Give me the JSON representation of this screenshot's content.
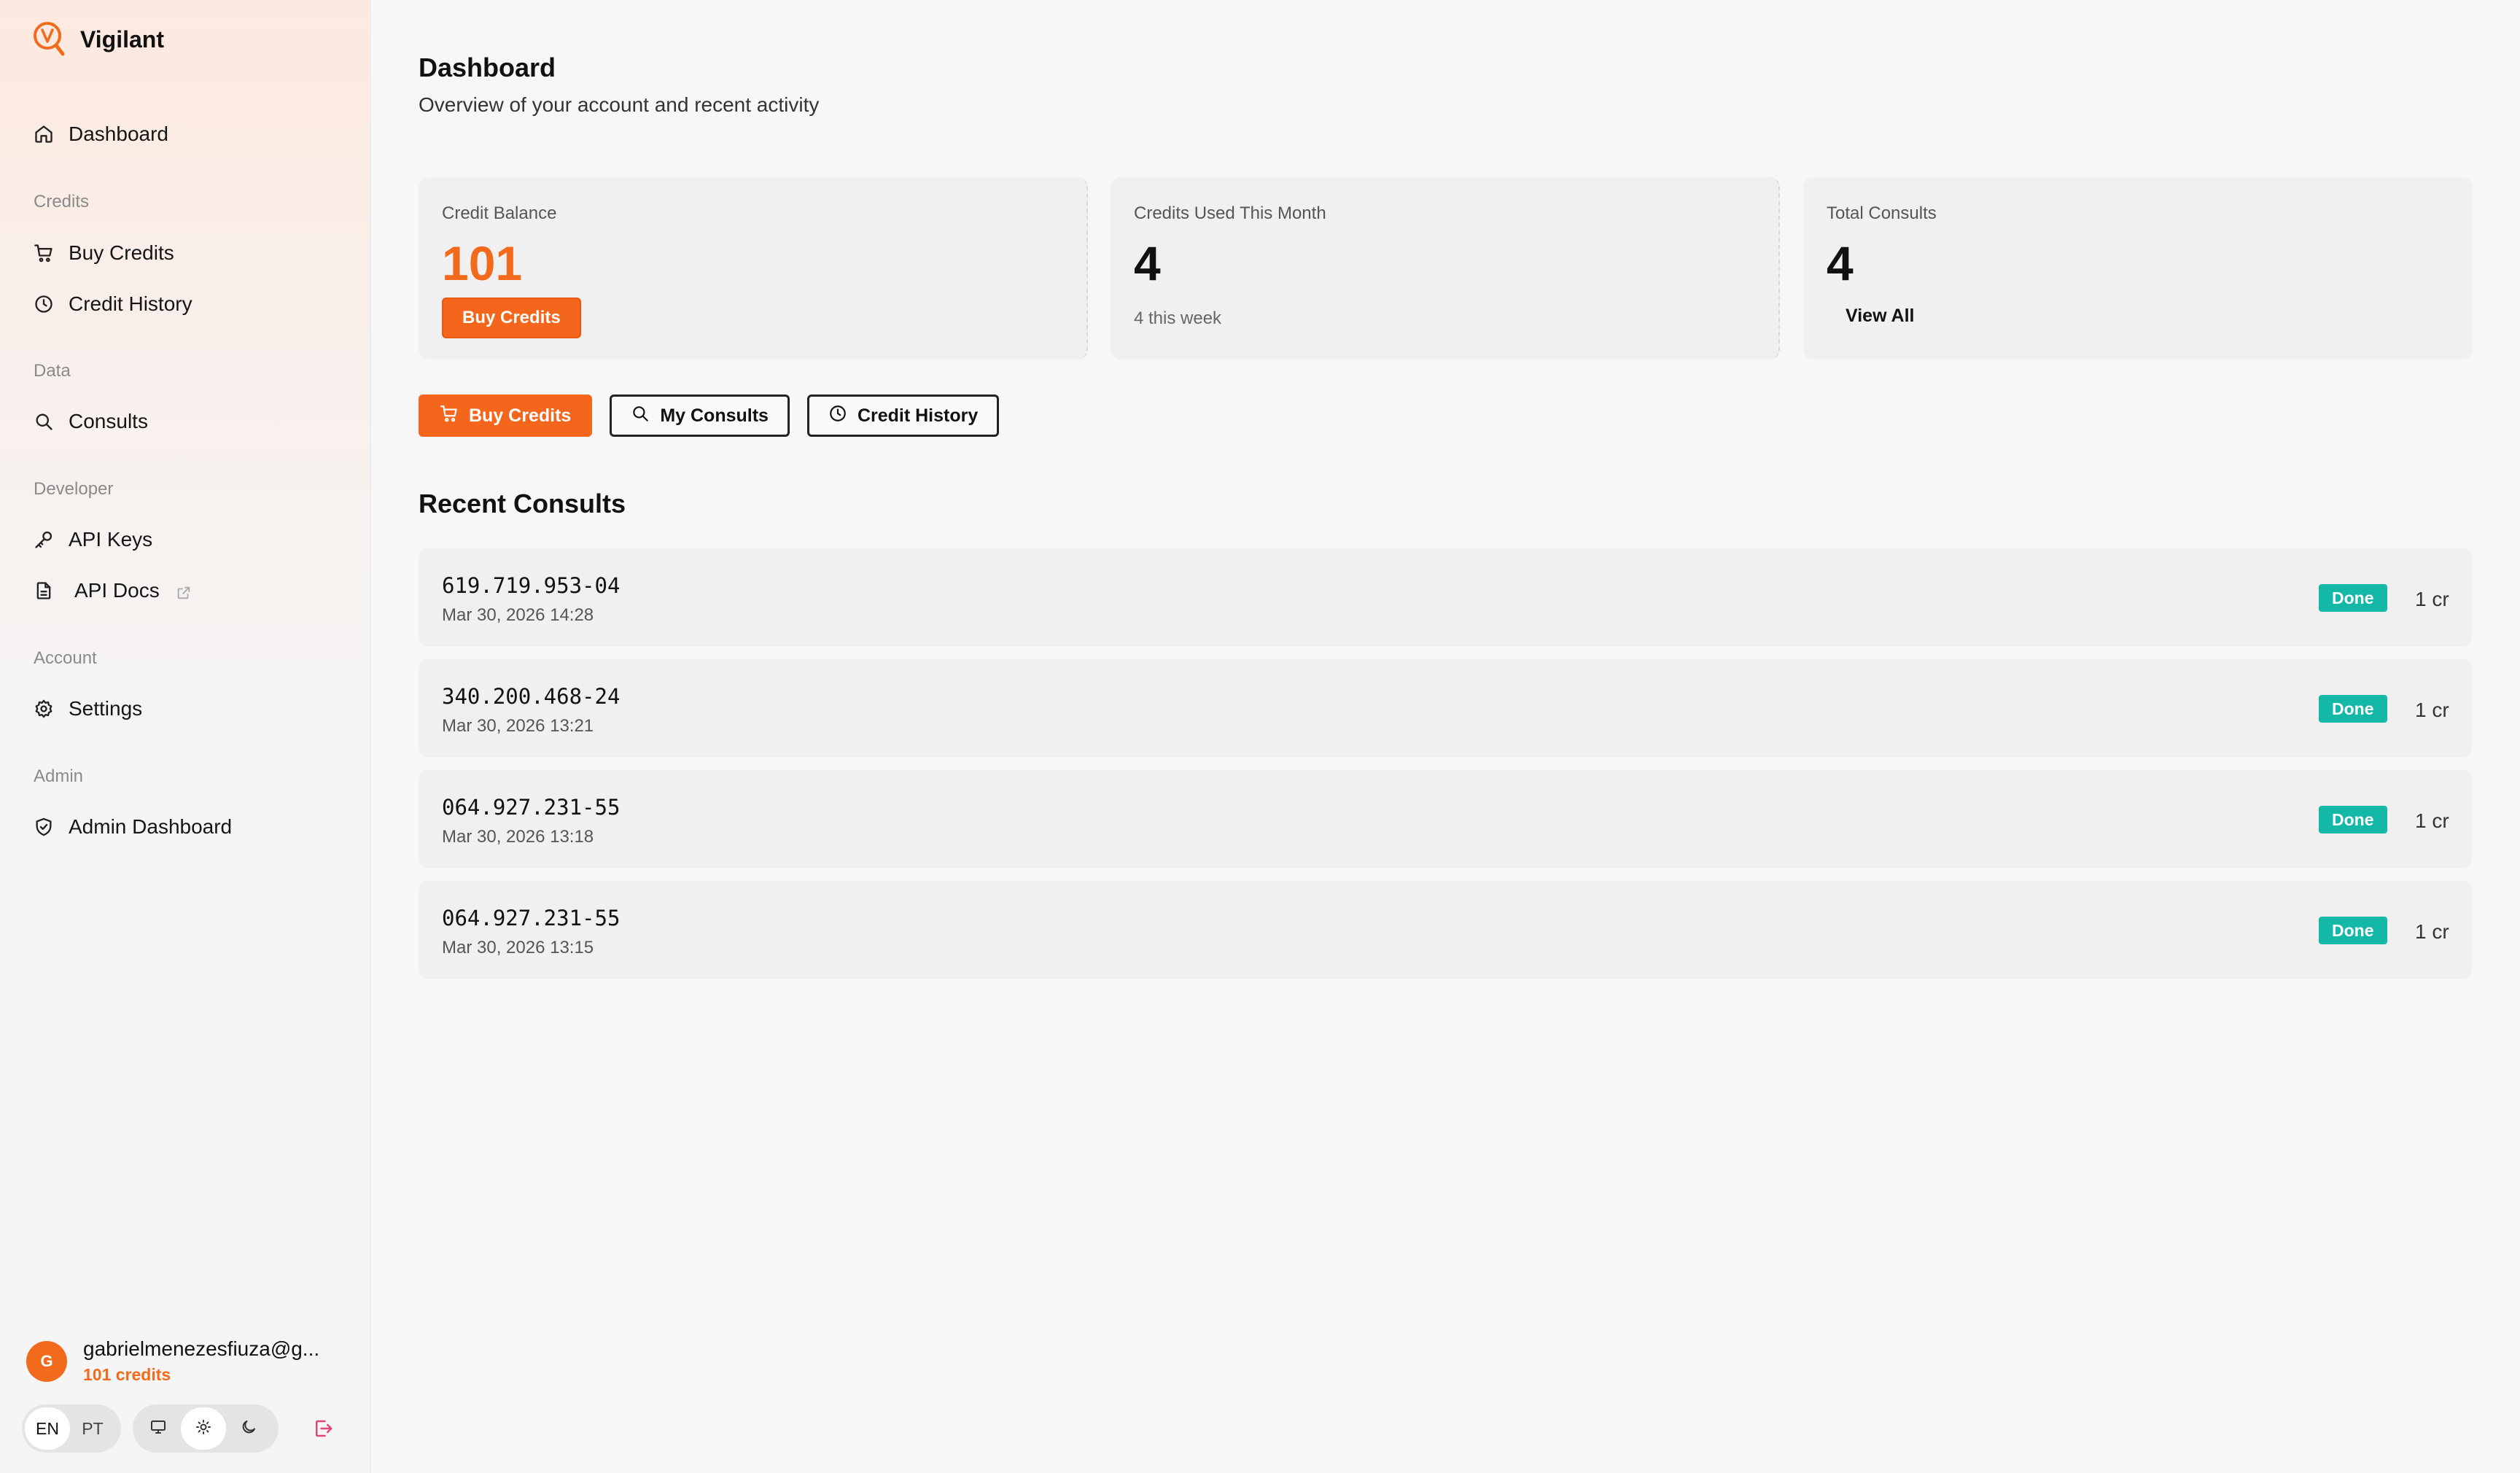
{
  "brand": {
    "name": "Vigilant",
    "accent": "#f26b1d"
  },
  "sidebar": {
    "items": [
      {
        "label": "Dashboard",
        "icon": "home-icon"
      },
      {
        "label": "Buy Credits",
        "icon": "cart-icon"
      },
      {
        "label": "Credit History",
        "icon": "clock-icon"
      },
      {
        "label": "Consults",
        "icon": "search-icon"
      },
      {
        "label": "API Keys",
        "icon": "key-icon"
      },
      {
        "label": "API Docs",
        "icon": "file-icon"
      },
      {
        "label": "Settings",
        "icon": "gear-icon"
      },
      {
        "label": "Admin Dashboard",
        "icon": "shield-icon"
      }
    ],
    "sections": [
      "Credits",
      "Data",
      "Developer",
      "Account",
      "Admin"
    ]
  },
  "user": {
    "avatar_letter": "G",
    "email": "gabrielmenezesfiuza@g...",
    "credits": "101 credits"
  },
  "language": {
    "options": [
      "EN",
      "PT"
    ],
    "selected": "EN"
  },
  "theme": {
    "options": [
      "monitor-icon",
      "sun-icon",
      "moon-icon"
    ],
    "selected": "sun-icon"
  },
  "page": {
    "title": "Dashboard",
    "subtitle": "Overview of your account and recent activity"
  },
  "cards": {
    "balance": {
      "label": "Credit Balance",
      "value": "101",
      "button": "Buy Credits"
    },
    "used": {
      "label": "Credits Used This Month",
      "value": "4",
      "sub": "4 this week"
    },
    "total": {
      "label": "Total Consults",
      "value": "4",
      "link": "View All"
    }
  },
  "actions": {
    "buy": "Buy Credits",
    "consults": "My Consults",
    "history": "Credit History"
  },
  "recent": {
    "title": "Recent Consults",
    "rows": [
      {
        "doc": "619.719.953-04",
        "date": "Mar 30, 2026 14:28",
        "status": "Done",
        "cost": "1 cr"
      },
      {
        "doc": "340.200.468-24",
        "date": "Mar 30, 2026 13:21",
        "status": "Done",
        "cost": "1 cr"
      },
      {
        "doc": "064.927.231-55",
        "date": "Mar 30, 2026 13:18",
        "status": "Done",
        "cost": "1 cr"
      },
      {
        "doc": "064.927.231-55",
        "date": "Mar 30, 2026 13:15",
        "status": "Done",
        "cost": "1 cr"
      }
    ]
  },
  "colors": {
    "status_done": "#14b8a6",
    "primary_button": "#f4661b"
  }
}
